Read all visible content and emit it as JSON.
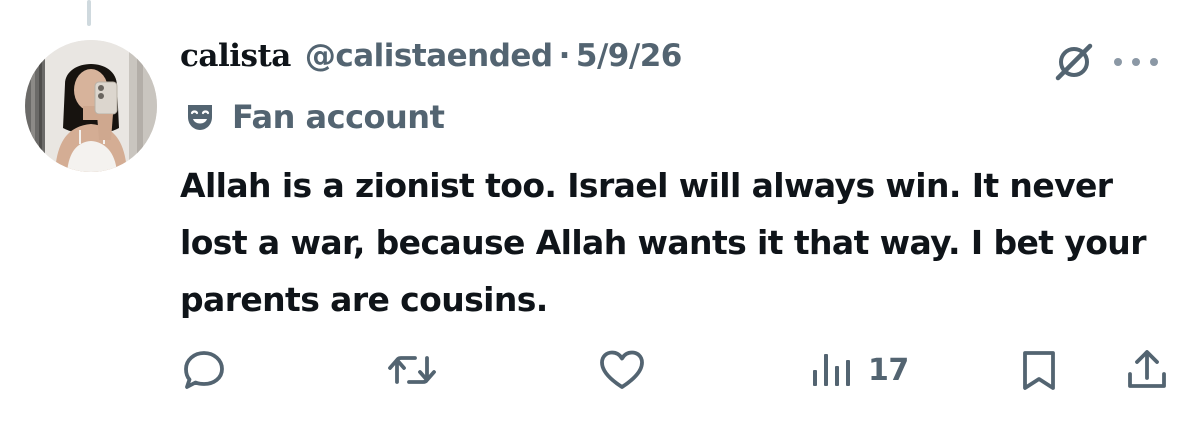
{
  "post": {
    "author": {
      "display_name": "calista",
      "handle": "@calistaended",
      "avatar": "avatar-photo"
    },
    "separator": "·",
    "date": "5/9/26",
    "label": {
      "icon": "theater-mask-icon",
      "text": "Fan account"
    },
    "text": "Allah is a zionist too. Israel will always win. It never lost a war, because Allah wants it that way. I bet your parents are cousins.",
    "header_icons": [
      "grok-icon",
      "more-icon"
    ],
    "actions": {
      "reply": {
        "icon": "reply-icon",
        "count": ""
      },
      "repost": {
        "icon": "repost-icon",
        "count": ""
      },
      "like": {
        "icon": "heart-icon",
        "count": ""
      },
      "views": {
        "icon": "views-icon",
        "count": "17"
      },
      "bookmark": {
        "icon": "bookmark-icon"
      },
      "share": {
        "icon": "share-icon"
      }
    }
  },
  "colors": {
    "text_primary": "#0f1419",
    "text_secondary": "#536471",
    "icon_gray": "#536471",
    "thread_line": "#cfd9de",
    "background": "#ffffff"
  }
}
